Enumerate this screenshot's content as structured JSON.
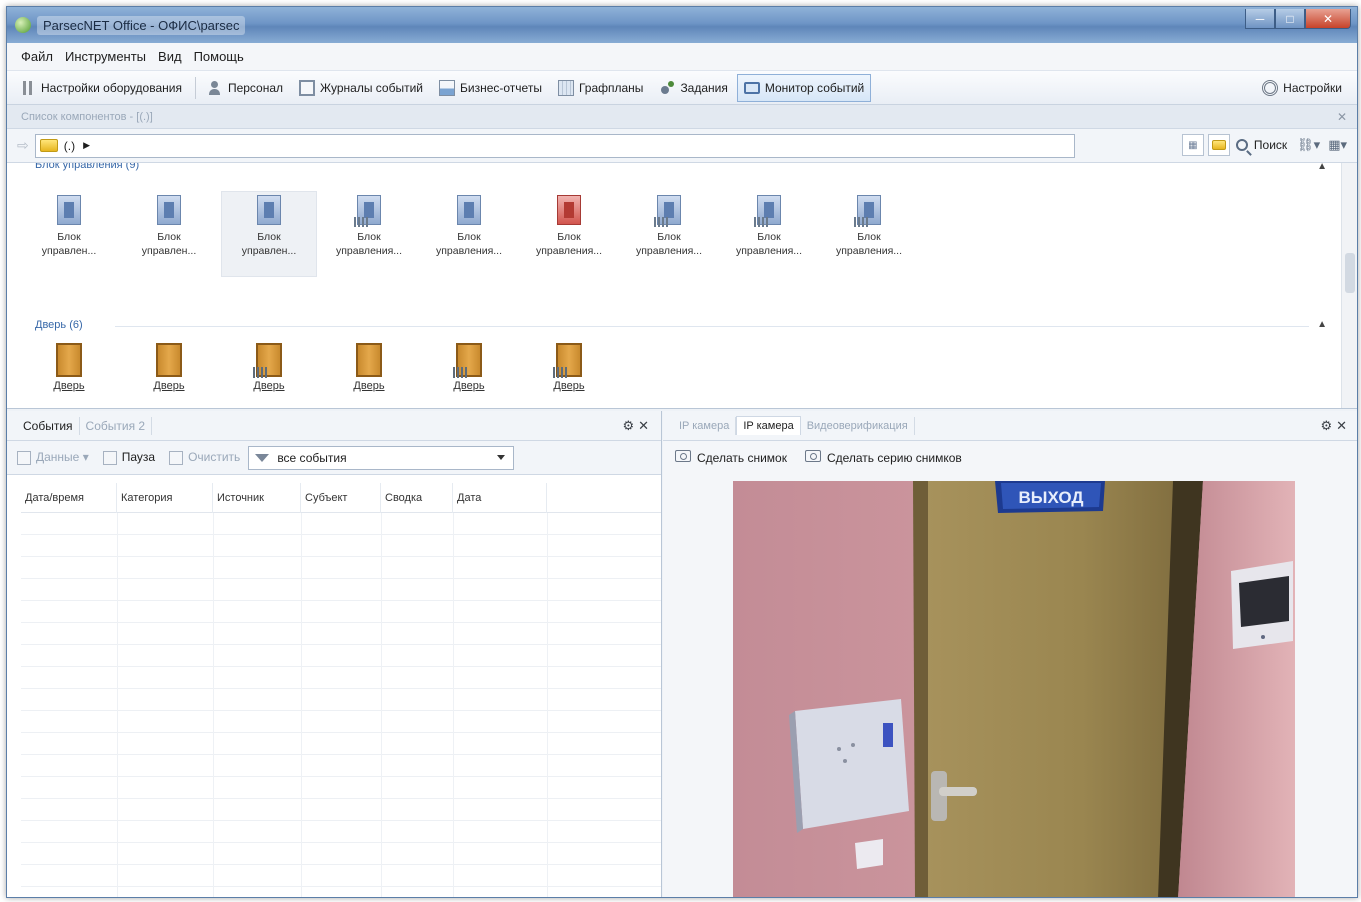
{
  "window": {
    "title": "ParsecNET Office - ОФИС\\parsec",
    "controls": [
      "minimize",
      "maximize",
      "close"
    ]
  },
  "menu": [
    "Файл",
    "Инструменты",
    "Вид",
    "Помощь"
  ],
  "toolbar": {
    "items": [
      {
        "label": "Настройки оборудования",
        "icon": "tools-icon"
      },
      {
        "label": "Персонал",
        "icon": "person-icon"
      },
      {
        "label": "Журналы событий",
        "icon": "journal-icon"
      },
      {
        "label": "Бизнес-отчеты",
        "icon": "chart-icon"
      },
      {
        "label": "Графпланы",
        "icon": "plan-icon"
      },
      {
        "label": "Задания",
        "icon": "task-icon"
      },
      {
        "label": "Монитор событий",
        "icon": "monitor-icon",
        "active": true
      }
    ],
    "settings_label": "Настройки"
  },
  "components": {
    "header": "Список компонентов - [(.)]",
    "path": "(.)",
    "search_label": "Поиск",
    "groups": [
      {
        "title": "Блок управления (9)",
        "items": [
          {
            "line1": "Блок",
            "line2": "управлен...",
            "type": "plain"
          },
          {
            "line1": "Блок",
            "line2": "управлен...",
            "type": "plain"
          },
          {
            "line1": "Блок",
            "line2": "управлен...",
            "type": "plain",
            "selected": true
          },
          {
            "line1": "Блок",
            "line2": "управления...",
            "type": "wired"
          },
          {
            "line1": "Блок",
            "line2": "управления...",
            "type": "plain"
          },
          {
            "line1": "Блок",
            "line2": "управления...",
            "type": "alarm"
          },
          {
            "line1": "Блок",
            "line2": "управления...",
            "type": "wired"
          },
          {
            "line1": "Блок",
            "line2": "управления...",
            "type": "wired"
          },
          {
            "line1": "Блок",
            "line2": "управления...",
            "type": "wired"
          }
        ]
      },
      {
        "title": "Дверь (6)",
        "items": [
          {
            "label": "Дверь",
            "type": "plain"
          },
          {
            "label": "Дверь",
            "type": "plain"
          },
          {
            "label": "Дверь",
            "type": "wired"
          },
          {
            "label": "Дверь",
            "type": "plain"
          },
          {
            "label": "Дверь",
            "type": "wired"
          },
          {
            "label": "Дверь",
            "type": "wired"
          }
        ]
      }
    ]
  },
  "events": {
    "tabs": [
      "События",
      "События 2"
    ],
    "toolbar": {
      "data_label": "Данные",
      "pause_label": "Пауза",
      "clear_label": "Очистить",
      "filter_value": "все события"
    },
    "columns": [
      "Дата/время",
      "Категория",
      "Источник",
      "Субъект",
      "Сводка",
      "Дата"
    ]
  },
  "camera": {
    "tabs": [
      "IP камера",
      "IP камера",
      "Видеоверификация"
    ],
    "active_tab": 1,
    "snapshot_label": "Сделать снимок",
    "series_label": "Сделать серию снимков",
    "exit_sign": "ВЫХОД"
  }
}
